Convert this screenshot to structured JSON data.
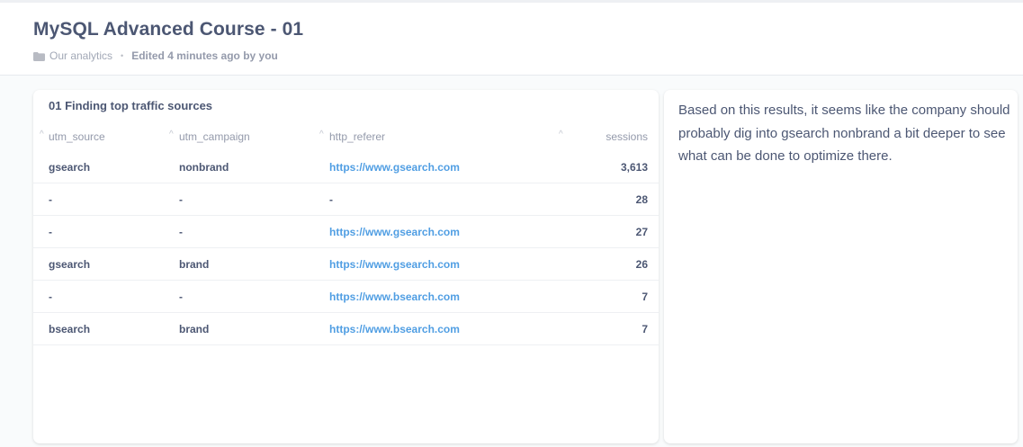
{
  "header": {
    "title": "MySQL Advanced Course - 01",
    "collection": "Our analytics",
    "separator": "•",
    "edited": "Edited 4 minutes ago by you"
  },
  "table_card": {
    "title": "01 Finding top traffic sources",
    "columns": [
      "utm_source",
      "utm_campaign",
      "http_referer",
      "sessions"
    ],
    "sort_icon": "^",
    "rows": [
      [
        "gsearch",
        "nonbrand",
        "https://www.gsearch.com",
        "3,613"
      ],
      [
        "-",
        "-",
        "-",
        "28"
      ],
      [
        "-",
        "-",
        "https://www.gsearch.com",
        "27"
      ],
      [
        "gsearch",
        "brand",
        "https://www.gsearch.com",
        "26"
      ],
      [
        "-",
        "-",
        "https://www.bsearch.com",
        "7"
      ],
      [
        "bsearch",
        "brand",
        "https://www.bsearch.com",
        "7"
      ]
    ]
  },
  "text_card": {
    "text": "Based on this results, it seems like the company should probably dig into gsearch nonbrand a bit deeper to see what can be done to optimize there."
  },
  "colors": {
    "link": "#509ee3",
    "text": "#4c5773",
    "muted": "#949aab",
    "background": "#f9fbfc"
  }
}
